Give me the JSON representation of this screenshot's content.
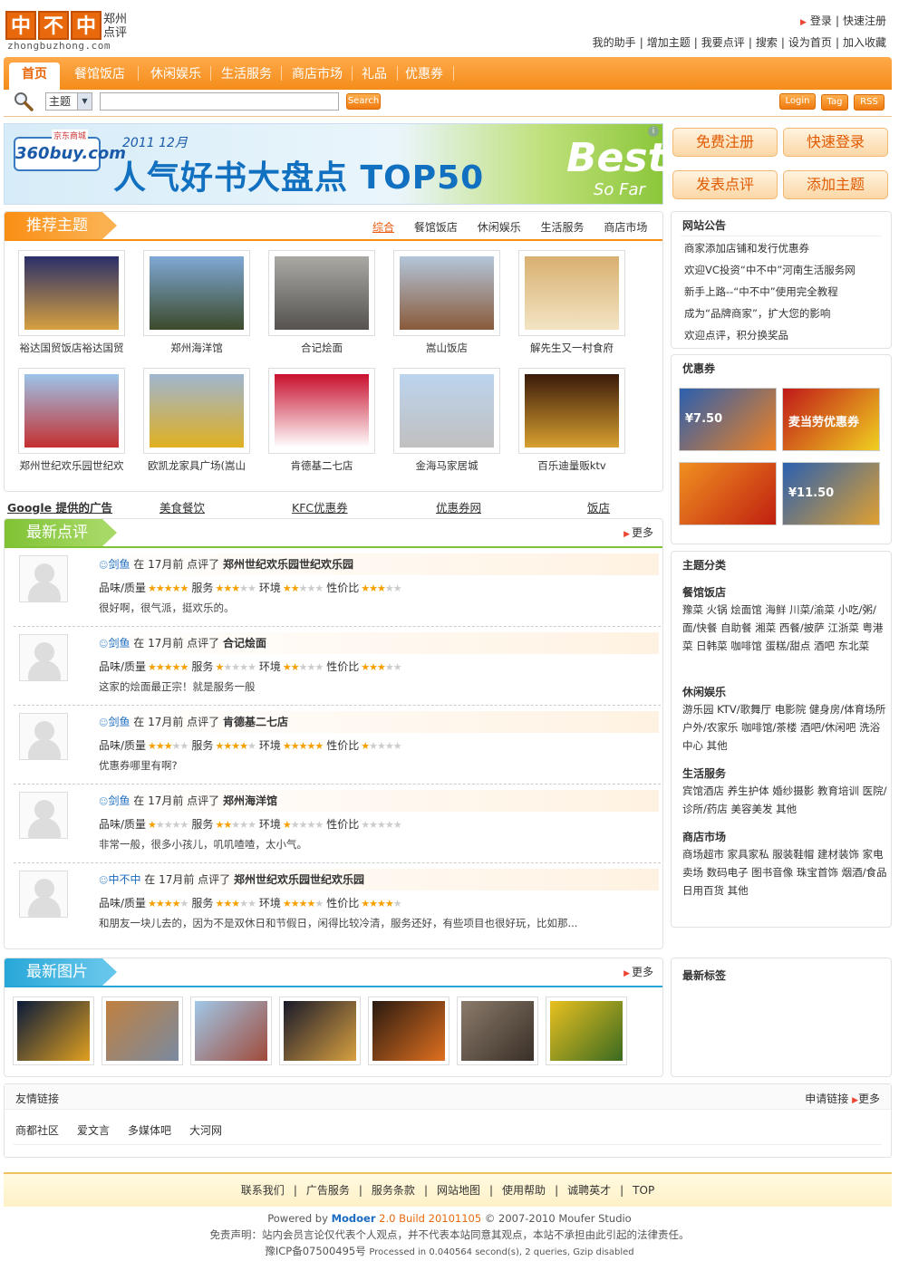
{
  "header": {
    "logo_chars": [
      "中",
      "不",
      "中"
    ],
    "logo_city": "郑州",
    "logo_sub": "点评",
    "logo_domain": "zhongbuzhong.com",
    "top_links_1": [
      "登录",
      "快速注册"
    ],
    "top_links_2": [
      "我的助手",
      "增加主题",
      "我要点评",
      "搜索",
      "设为首页",
      "加入收藏"
    ]
  },
  "nav": {
    "items": [
      "首页",
      "餐馆饭店",
      "休闲娱乐",
      "生活服务",
      "商店市场",
      "礼品",
      "优惠券"
    ]
  },
  "search": {
    "select_value": "主题",
    "button": "Search",
    "right_buttons": [
      "Login",
      "Tag",
      "RSS"
    ]
  },
  "banner": {
    "brand": "360buy.com",
    "brand_tag": "京东商城",
    "year": "2011 12月",
    "headline": "人气好书大盘点 TOP50",
    "best": "Best",
    "sofar": "So Far"
  },
  "right_buttons": [
    "免费注册",
    "快速登录",
    "发表点评",
    "添加主题"
  ],
  "recommend": {
    "title": "推荐主题",
    "tabs": [
      "综合",
      "餐馆饭店",
      "休闲娱乐",
      "生活服务",
      "商店市场"
    ],
    "items": [
      {
        "name": "裕达国贸饭店裕达国贸",
        "c1": "#2a2f6a",
        "c2": "#d7a040"
      },
      {
        "name": "郑州海洋馆",
        "c1": "#7fa9d6",
        "c2": "#3c4a2a"
      },
      {
        "name": "合记烩面",
        "c1": "#aaa9a4",
        "c2": "#555250"
      },
      {
        "name": "嵩山饭店",
        "c1": "#b3c6da",
        "c2": "#8a5a3a"
      },
      {
        "name": "解先生又一村食府",
        "c1": "#d8b070",
        "c2": "#f3e4c4"
      },
      {
        "name": "郑州世纪欢乐园世纪欢",
        "c1": "#9cc4ea",
        "c2": "#c43030"
      },
      {
        "name": "欧凯龙家具广场(嵩山",
        "c1": "#9fb6d0",
        "c2": "#e0b020"
      },
      {
        "name": "肯德基二七店",
        "c1": "#c8102e",
        "c2": "#ffffff"
      },
      {
        "name": "金海马家居城",
        "c1": "#bcd4ee",
        "c2": "#c0c0c0"
      },
      {
        "name": "百乐迪量贩ktv",
        "c1": "#3a1a0a",
        "c2": "#d8a030"
      }
    ]
  },
  "ads": [
    "Google 提供的广告",
    "美食餐饮",
    "KFC优惠券",
    "优惠券网",
    "饭店"
  ],
  "reviews": {
    "title": "最新点评",
    "more": "更多",
    "labels": [
      "品味/质量",
      "服务",
      "环境",
      "性价比"
    ],
    "items": [
      {
        "user": "剑鱼",
        "time": "在 17月前 点评了",
        "place": "郑州世纪欢乐园世纪欢乐园",
        "scores": [
          5,
          3,
          2,
          3
        ],
        "text": "很好啊，很气派，挺欢乐的。"
      },
      {
        "user": "剑鱼",
        "time": "在 17月前 点评了",
        "place": "合记烩面",
        "scores": [
          5,
          1,
          2,
          3
        ],
        "text": "这家的烩面最正宗！就是服务一般"
      },
      {
        "user": "剑鱼",
        "time": "在 17月前 点评了",
        "place": "肯德基二七店",
        "scores": [
          3,
          4,
          5,
          1
        ],
        "text": "优惠券哪里有啊?"
      },
      {
        "user": "剑鱼",
        "time": "在 17月前 点评了",
        "place": "郑州海洋馆",
        "scores": [
          1,
          2,
          1,
          0
        ],
        "text": "非常一般，很多小孩儿，叽叽喳喳，太小气。"
      },
      {
        "user": "中不中",
        "time": "在 17月前 点评了",
        "place": "郑州世纪欢乐园世纪欢乐园",
        "scores": [
          4,
          3,
          4,
          4
        ],
        "text": "和朋友一块儿去的，因为不是双休日和节假日，闲得比较冷清，服务还好，有些项目也很好玩，比如那..."
      }
    ]
  },
  "photos": {
    "title": "最新图片",
    "more": "更多",
    "items": [
      {
        "c1": "#0a1a3a",
        "c2": "#e0a020"
      },
      {
        "c1": "#c08040",
        "c2": "#7a8aa0"
      },
      {
        "c1": "#a0c8e8",
        "c2": "#a04a3a"
      },
      {
        "c1": "#1a1a2a",
        "c2": "#d8a040"
      },
      {
        "c1": "#2a1a10",
        "c2": "#e07020"
      },
      {
        "c1": "#8a7a6a",
        "c2": "#3a3028"
      },
      {
        "c1": "#e8c020",
        "c2": "#3a6a20"
      }
    ]
  },
  "notice": {
    "title": "网站公告",
    "items": [
      "商家添加店铺和发行优惠券",
      "欢迎VC投资“中不中”河南生活服务网",
      "新手上路--“中不中”使用完全教程",
      "成为“品牌商家”，扩大您的影响",
      "欢迎点评，积分换奖品"
    ]
  },
  "coupons": {
    "title": "优惠券",
    "items": [
      {
        "c1": "#2a60b0",
        "c2": "#f08020",
        "label": "¥7.50"
      },
      {
        "c1": "#c01818",
        "c2": "#f0d020",
        "label": "麦当劳优惠券"
      },
      {
        "c1": "#f09020",
        "c2": "#c02010",
        "label": ""
      },
      {
        "c1": "#2a60b0",
        "c2": "#e0a030",
        "label": "¥11.50"
      }
    ]
  },
  "categories": {
    "title": "主题分类",
    "groups": [
      {
        "name": "餐馆饭店",
        "items": "豫菜  火锅  烩面馆  海鲜  川菜/渝菜  小吃/粥/面/快餐  自助餐  湘菜  西餐/披萨  江浙菜  粤港菜  日韩菜  咖啡馆  蛋糕/甜点  酒吧  东北菜"
      },
      {
        "name": "休闲娱乐",
        "items": "游乐园  KTV/歌舞厅  电影院  健身房/体育场所  户外/农家乐  咖啡馆/茶楼  酒吧/休闲吧  洗浴中心  其他"
      },
      {
        "name": "生活服务",
        "items": "宾馆酒店  养生护体  婚纱摄影  教育培训  医院/诊所/药店  美容美发  其他"
      },
      {
        "name": "商店市场",
        "items": "商场超市  家具家私  服装鞋帽  建材装饰  家电卖场  数码电子  图书音像  珠宝首饰  烟酒/食品  日用百货  其他"
      }
    ]
  },
  "tags": {
    "title": "最新标签"
  },
  "friend_links": {
    "title": "友情链接",
    "apply": "申请链接",
    "more": "更多",
    "items": [
      "商都社区",
      "爱文言",
      "多媒体吧",
      "大河网"
    ]
  },
  "footer": {
    "links": [
      "联系我们",
      "广告服务",
      "服务条款",
      "网站地图",
      "使用帮助",
      "诚聘英才",
      "TOP"
    ],
    "powered_pre": "Powered by ",
    "powered_name": "Modoer",
    "powered_ver": " 2.0 Build 20101105",
    "powered_post": " © 2007-2010 Moufer Studio",
    "disclaimer": "免责声明：站内会员言论仅代表个人观点，并不代表本站同意其观点，本站不承担由此引起的法律责任。",
    "icp": "豫ICP备07500495号",
    "processed": "Processed in 0.040564 second(s), 2 queries, Gzip disabled"
  },
  "colors": {
    "accent": "#f48c1a",
    "link": "#1a6bc0",
    "star": "#f5a000"
  }
}
